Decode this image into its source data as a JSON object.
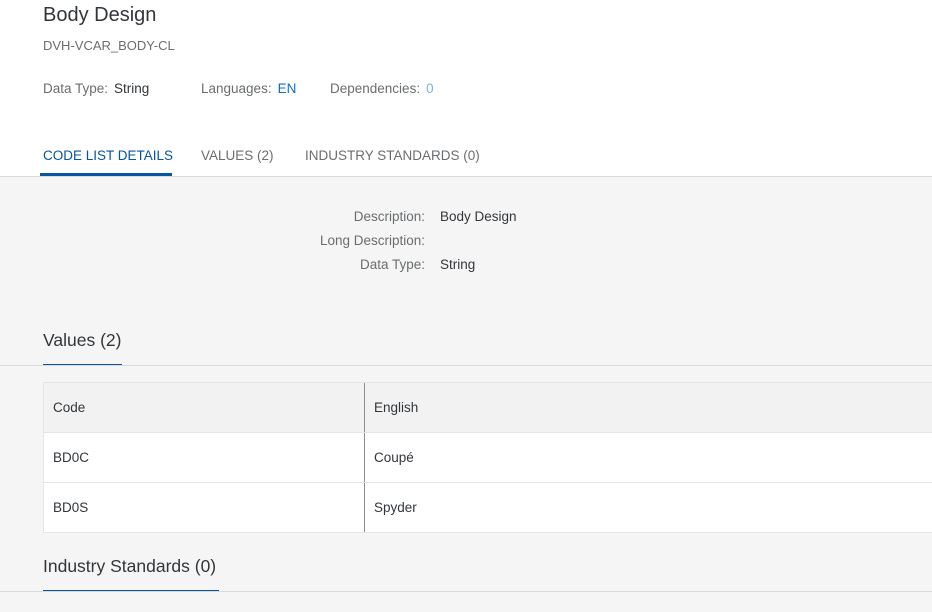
{
  "header": {
    "title": "Body Design",
    "code": "DVH-VCAR_BODY-CL",
    "attributes": {
      "data_type_label": "Data Type:",
      "data_type_value": "String",
      "languages_label": "Languages:",
      "languages_value": "EN",
      "dependencies_label": "Dependencies:",
      "dependencies_value": "0"
    }
  },
  "tabs": [
    {
      "label": "CODE LIST DETAILS",
      "active": true
    },
    {
      "label": "VALUES (2)",
      "active": false
    },
    {
      "label": "INDUSTRY STANDARDS (0)",
      "active": false
    }
  ],
  "details": {
    "description_label": "Description:",
    "description_value": "Body Design",
    "long_description_label": "Long Description:",
    "long_description_value": "",
    "data_type_label": "Data Type:",
    "data_type_value": "String"
  },
  "values_section": {
    "title": "Values (2)",
    "columns": [
      "Code",
      "English"
    ],
    "rows": [
      {
        "code": "BD0C",
        "english": "Coupé"
      },
      {
        "code": "BD0S",
        "english": "Spyder"
      }
    ]
  },
  "industry_section": {
    "title": "Industry Standards (0)"
  },
  "colors": {
    "accent": "#0854a0",
    "link": "#0a6ed1",
    "background": "#f5f5f5"
  }
}
